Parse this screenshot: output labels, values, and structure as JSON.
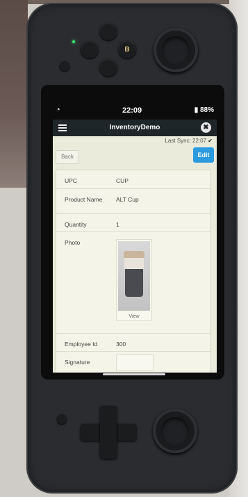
{
  "status_bar": {
    "time": "22:09",
    "battery": "88%",
    "wifi_icon": "wifi-icon",
    "battery_icon": "battery-icon"
  },
  "app": {
    "title": "InventoryDemo",
    "menu_icon": "hamburger-menu-icon",
    "close_icon": "close-icon",
    "close_glyph": "✖"
  },
  "sync": {
    "label": "Last Sync: 22:07",
    "check": "✔"
  },
  "toolbar": {
    "back_label": "Back",
    "edit_label": "Edit"
  },
  "fields": [
    {
      "label": "UPC",
      "value": "CUP"
    },
    {
      "label": "Product Name",
      "value": "ALT Cup"
    },
    {
      "label": "Quantity",
      "value": "1"
    },
    {
      "label": "Photo",
      "value": ""
    },
    {
      "label": "Employee Id",
      "value": "300"
    },
    {
      "label": "Signature",
      "value": ""
    }
  ],
  "photo": {
    "view_label": "View"
  },
  "colors": {
    "header": "#1f2629",
    "edit_button": "#2a9be0",
    "background": "#ebebdb"
  }
}
